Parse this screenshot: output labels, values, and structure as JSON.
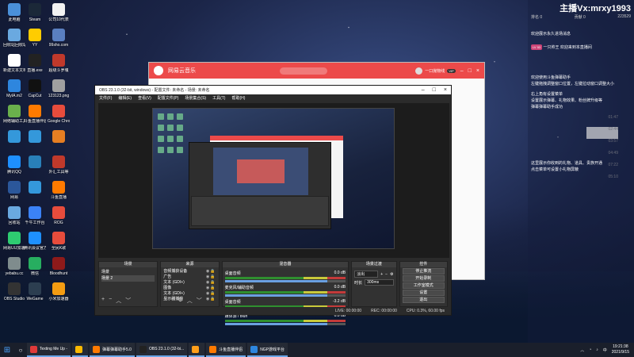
{
  "desktop_icons": [
    {
      "label": "此电脑",
      "color": "#4a90d9"
    },
    {
      "label": "Steam",
      "color": "#1b2838"
    },
    {
      "label": "公司10代表",
      "color": "#f2f2f2"
    },
    {
      "label": "回收站回收站",
      "color": "#6aa9e0"
    },
    {
      "label": "YY",
      "color": "#ffcc00"
    },
    {
      "label": "99sho.com",
      "color": "#5a7fc0"
    },
    {
      "label": "新建文本文档.txt",
      "color": "#ffffff"
    },
    {
      "label": "直播.exe",
      "color": "#222222"
    },
    {
      "label": "超级斗罗魂",
      "color": "#c0392b"
    },
    {
      "label": "MyIA.m2",
      "color": "#2e86de"
    },
    {
      "label": "CapCut",
      "color": "#111111"
    },
    {
      "label": "123123.png",
      "color": "#a0a0a0"
    },
    {
      "label": "网络辅助工具",
      "color": "#6ab04c"
    },
    {
      "label": "斗鱼直播伴侣",
      "color": "#ff7a00"
    },
    {
      "label": "Google Chrome",
      "color": "#e74c3c"
    },
    {
      "label": "",
      "color": "#3498db"
    },
    {
      "label": "",
      "color": "#3498db"
    },
    {
      "label": "",
      "color": "#e67e22"
    },
    {
      "label": "腾讯QQ",
      "color": "#1e90ff"
    },
    {
      "label": "",
      "color": "#2980b9"
    },
    {
      "label": "外汇工具等",
      "color": "#c0392b"
    },
    {
      "label": "网易",
      "color": "#2b579a"
    },
    {
      "label": "",
      "color": "#3498db"
    },
    {
      "label": "斗鱼直播",
      "color": "#ff7a00"
    },
    {
      "label": "回收站",
      "color": "#6aa9e0"
    },
    {
      "label": "千牛工作台",
      "color": "#3b82f6"
    },
    {
      "label": "ROG",
      "color": "#e74c3c"
    },
    {
      "label": "网易UU加速器",
      "color": "#2ecc71"
    },
    {
      "label": "腾讯会议官方",
      "color": "#1e90ff"
    },
    {
      "label": "全民K歌",
      "color": "#e74c3c"
    },
    {
      "label": "yebabu.cc",
      "color": "#7f8c8d"
    },
    {
      "label": "微信",
      "color": "#27ae60"
    },
    {
      "label": "Bloodhunt",
      "color": "#8e1a1a"
    },
    {
      "label": "OBS Studio",
      "color": "#333333"
    },
    {
      "label": "WeGame",
      "color": "#2c3e50"
    },
    {
      "label": "小米加速器",
      "color": "#f39c12"
    }
  ],
  "netease": {
    "title": "网易云音乐",
    "user_name": "一口抛物线",
    "vip_badge": "VIP",
    "times": [
      "01:47",
      "02:44",
      "03:57",
      "04:49",
      "07:22",
      "05:10"
    ]
  },
  "obs": {
    "title": "OBS 23.1.0 (32-bit, windows) - 配置文件: 未命名 - 场景: 未命名",
    "menu": [
      "文件(F)",
      "编辑(E)",
      "查看(V)",
      "配置文件(P)",
      "场景集合(S)",
      "工具(T)",
      "帮助(H)"
    ],
    "docks": {
      "scenes": {
        "title": "场景",
        "items": [
          "场景",
          "场景 2"
        ]
      },
      "sources": {
        "title": "来源",
        "items": [
          "音频捕获设备",
          "广告",
          "文本 (GDI+)",
          "图像",
          "文本 (GDI+)",
          "显示器捕获"
        ]
      },
      "mixer": {
        "title": "混音器",
        "rows": [
          {
            "name": "桌面音频",
            "db": "0.0 dB",
            "level": 0.85
          },
          {
            "name": "麦克风/辅助音频",
            "db": "0.0 dB",
            "level": 0.85
          },
          {
            "name": "桌面音频",
            "db": "-3.2 dB",
            "level": 0.75
          },
          {
            "name": "媒体源 / bluh",
            "db": "0.0 dB",
            "level": 0.85
          }
        ]
      },
      "transitions": {
        "title": "场景过渡",
        "type": "淡出",
        "duration_label": "时长",
        "duration": "300ms"
      },
      "controls": {
        "title": "控件",
        "buttons": [
          "停止推流",
          "开始录制",
          "工作室模式",
          "设置",
          "退出"
        ]
      }
    },
    "status": {
      "live": "LIVE: 00:00:00",
      "rec": "REC: 00:00:00",
      "cpu": "CPU: 0.3%, 60.00 fps"
    }
  },
  "chat": {
    "host": "主播Vx:mrxy1993",
    "stats_left": "排名 0",
    "stats_mid": "贡献 0",
    "stats_right": "223529",
    "lines": [
      "欢迎展示永久进场消息",
      "一只帅王 欢迎来到本直播间",
      "欢迎使用斗鱼弹幕助手",
      "左键拖拽调整窗口位置，左键拉动窗口调整大小",
      "右上角有设置菜单",
      "设置展示弹幕、礼物效果、粉丝牌升级等",
      "弹幕弹幕助手成功",
      "这里展示你收到的礼物、道具、贵族开通",
      "点击菜单可设置小礼物屏蔽"
    ],
    "badge": "LV 53"
  },
  "taskbar": {
    "start_icon": "windows-icon",
    "items": [
      {
        "label": "Texting Me Up -",
        "color": "#e03a3a"
      },
      {
        "label": "",
        "color": "#fcb900"
      },
      {
        "label": "弹幕弹幕助手5.0",
        "color": "#ff7a00"
      },
      {
        "label": "OBS 23.1.0 (32-bi...",
        "color": "#222222"
      },
      {
        "label": "",
        "color": "#ff9f1a"
      },
      {
        "label": "斗鱼直播伴侣",
        "color": "#ff7a00"
      },
      {
        "label": "NGP游戏平台",
        "color": "#2e86de"
      }
    ],
    "time": "19:21:38",
    "date": "2021/9/15"
  }
}
